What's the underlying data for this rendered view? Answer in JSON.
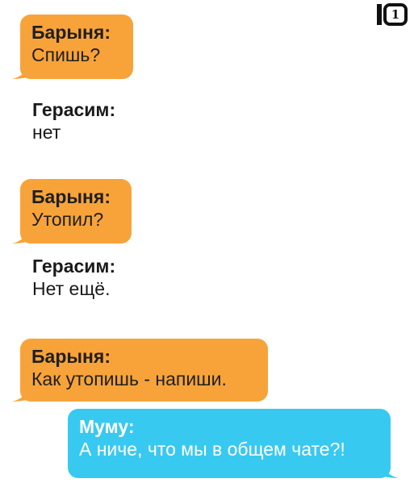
{
  "colors": {
    "orange_bubble": "#f7a33a",
    "blue_bubble": "#38c9f1"
  },
  "messages": [
    {
      "sender": "Барыня:",
      "text": "Спишь?",
      "style": "orange-bubble"
    },
    {
      "sender": "Герасим:",
      "text": "нет",
      "style": "plain"
    },
    {
      "sender": "Барыня:",
      "text": "Утопил?",
      "style": "orange-bubble"
    },
    {
      "sender": "Герасим:",
      "text": "Нет ещё.",
      "style": "plain"
    },
    {
      "sender": "Барыня:",
      "text": "Как утопишь - напиши.",
      "style": "orange-bubble"
    },
    {
      "sender": "Муму:",
      "text": "А ниче, что мы в общем чате?!",
      "style": "blue-bubble"
    }
  ],
  "logo": {
    "icon": "square-logo-icon"
  }
}
